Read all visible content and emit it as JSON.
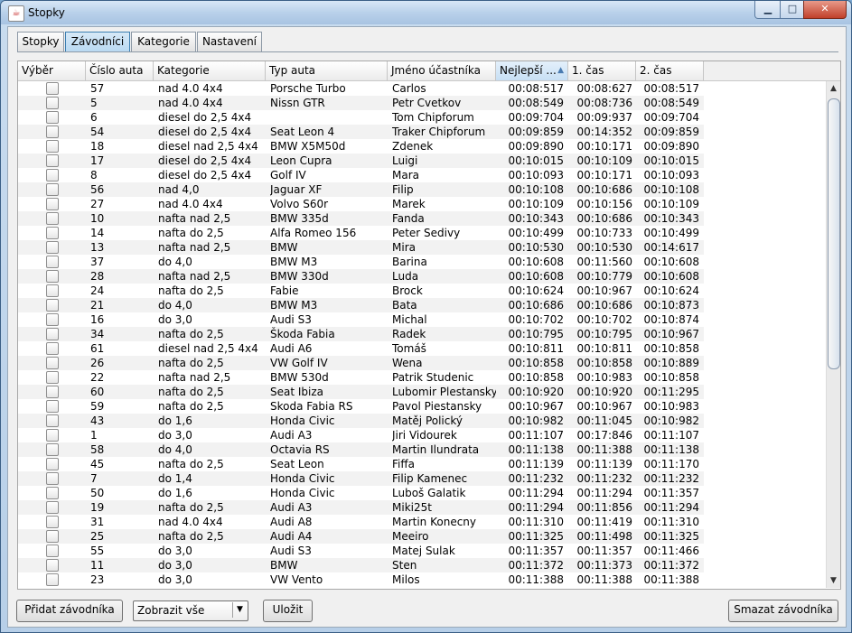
{
  "window": {
    "title": "Stopky"
  },
  "tabs": [
    "Stopky",
    "Závodníci",
    "Kategorie",
    "Nastavení"
  ],
  "table": {
    "columns": [
      "Výběr",
      "Číslo auta",
      "Kategorie",
      "Typ auta",
      "Jméno účastníka",
      "Nejlepší ...",
      "1. čas",
      "2. čas"
    ],
    "sorted_column": "Nejlepší ...",
    "rows": [
      [
        "57",
        "nad 4.0 4x4",
        "Porsche Turbo",
        "Carlos",
        "00:08:517",
        "00:08:627",
        "00:08:517"
      ],
      [
        "5",
        "nad 4.0 4x4",
        "Nissn GTR",
        "Petr Cvetkov",
        "00:08:549",
        "00:08:736",
        "00:08:549"
      ],
      [
        "6",
        "diesel do 2,5 4x4",
        "",
        "Tom Chipforum",
        "00:09:704",
        "00:09:937",
        "00:09:704"
      ],
      [
        "54",
        "diesel do 2,5 4x4",
        "Seat Leon 4",
        "Traker Chipforum",
        "00:09:859",
        "00:14:352",
        "00:09:859"
      ],
      [
        "18",
        "diesel nad 2,5 4x4",
        "BMW X5M50d",
        "Zdenek",
        "00:09:890",
        "00:10:171",
        "00:09:890"
      ],
      [
        "17",
        "diesel do 2,5 4x4",
        "Leon Cupra",
        "Luigi",
        "00:10:015",
        "00:10:109",
        "00:10:015"
      ],
      [
        "8",
        "diesel do 2,5 4x4",
        "Golf IV",
        "Mara",
        "00:10:093",
        "00:10:171",
        "00:10:093"
      ],
      [
        "56",
        "nad 4,0",
        "Jaguar XF",
        "Filip",
        "00:10:108",
        "00:10:686",
        "00:10:108"
      ],
      [
        "27",
        "nad 4.0 4x4",
        "Volvo S60r",
        "Marek",
        "00:10:109",
        "00:10:156",
        "00:10:109"
      ],
      [
        "10",
        "nafta nad 2,5",
        "BMW 335d",
        "Fanda",
        "00:10:343",
        "00:10:686",
        "00:10:343"
      ],
      [
        "14",
        "nafta do 2,5",
        "Alfa Romeo 156",
        "Peter Sedivy",
        "00:10:499",
        "00:10:733",
        "00:10:499"
      ],
      [
        "13",
        "nafta nad 2,5",
        "BMW",
        "Mira",
        "00:10:530",
        "00:10:530",
        "00:14:617"
      ],
      [
        "37",
        "do 4,0",
        "BMW M3",
        "Barina",
        "00:10:608",
        "00:11:560",
        "00:10:608"
      ],
      [
        "28",
        "nafta nad 2,5",
        "BMW 330d",
        "Luda",
        "00:10:608",
        "00:10:779",
        "00:10:608"
      ],
      [
        "24",
        "nafta do 2,5",
        "Fabie",
        "Brock",
        "00:10:624",
        "00:10:967",
        "00:10:624"
      ],
      [
        "21",
        "do 4,0",
        "BMW M3",
        "Bata",
        "00:10:686",
        "00:10:686",
        "00:10:873"
      ],
      [
        "16",
        "do 3,0",
        "Audi S3",
        "Michal",
        "00:10:702",
        "00:10:702",
        "00:10:874"
      ],
      [
        "34",
        "nafta do 2,5",
        "Škoda Fabia",
        "Radek",
        "00:10:795",
        "00:10:795",
        "00:10:967"
      ],
      [
        "61",
        "diesel nad 2,5 4x4",
        "Audi A6",
        "Tomáš",
        "00:10:811",
        "00:10:811",
        "00:10:858"
      ],
      [
        "26",
        "nafta do 2,5",
        "VW Golf IV",
        "Wena",
        "00:10:858",
        "00:10:858",
        "00:10:889"
      ],
      [
        "22",
        "nafta nad 2,5",
        "BMW 530d",
        "Patrik Studenic",
        "00:10:858",
        "00:10:983",
        "00:10:858"
      ],
      [
        "60",
        "nafta do 2,5",
        "Seat Ibiza",
        "Lubomir Plestansky",
        "00:10:920",
        "00:10:920",
        "00:11:295"
      ],
      [
        "59",
        "nafta do 2,5",
        "Skoda Fabia RS",
        "Pavol Piestansky",
        "00:10:967",
        "00:10:967",
        "00:10:983"
      ],
      [
        "43",
        "do 1,6",
        "Honda Civic",
        "Matěj Polický",
        "00:10:982",
        "00:11:045",
        "00:10:982"
      ],
      [
        "1",
        "do 3,0",
        "Audi A3",
        "Jiri Vidourek",
        "00:11:107",
        "00:17:846",
        "00:11:107"
      ],
      [
        "58",
        "do 4,0",
        "Octavia RS",
        "Martin Ilundrata",
        "00:11:138",
        "00:11:388",
        "00:11:138"
      ],
      [
        "45",
        "nafta do 2,5",
        "Seat Leon",
        "Fiffa",
        "00:11:139",
        "00:11:139",
        "00:11:170"
      ],
      [
        "7",
        "do 1,4",
        "Honda Civic",
        "Filip Kamenec",
        "00:11:232",
        "00:11:232",
        "00:11:232"
      ],
      [
        "50",
        "do 1,6",
        "Honda Civic",
        "Luboš Galatik",
        "00:11:294",
        "00:11:294",
        "00:11:357"
      ],
      [
        "19",
        "nafta do 2,5",
        "Audi A3",
        "Miki25t",
        "00:11:294",
        "00:11:856",
        "00:11:294"
      ],
      [
        "31",
        "nad 4.0 4x4",
        "Audi A8",
        "Martin Konecny",
        "00:11:310",
        "00:11:419",
        "00:11:310"
      ],
      [
        "25",
        "nafta do 2,5",
        "Audi A4",
        "Meeiro",
        "00:11:325",
        "00:11:498",
        "00:11:325"
      ],
      [
        "55",
        "do 3,0",
        "Audi S3",
        "Matej Sulak",
        "00:11:357",
        "00:11:357",
        "00:11:466"
      ],
      [
        "11",
        "do 3,0",
        "BMW",
        "Sten",
        "00:11:372",
        "00:11:373",
        "00:11:372"
      ],
      [
        "23",
        "do 3,0",
        "VW Vento",
        "Milos",
        "00:11:388",
        "00:11:388",
        "00:11:388"
      ]
    ]
  },
  "buttons": {
    "add": "Přidat závodníka",
    "filter_value": "Zobrazit vše",
    "save": "Uložit",
    "delete": "Smazat závodníka"
  },
  "icons": {
    "app": "java-icon",
    "minimize": "minimize-icon",
    "maximize": "maximize-icon",
    "close": "close-icon",
    "sort": "sort-ascending-icon",
    "scroll_up": "scroll-up-arrow-icon",
    "scroll_down": "scroll-down-arrow-icon",
    "dropdown": "chevron-down-icon"
  }
}
